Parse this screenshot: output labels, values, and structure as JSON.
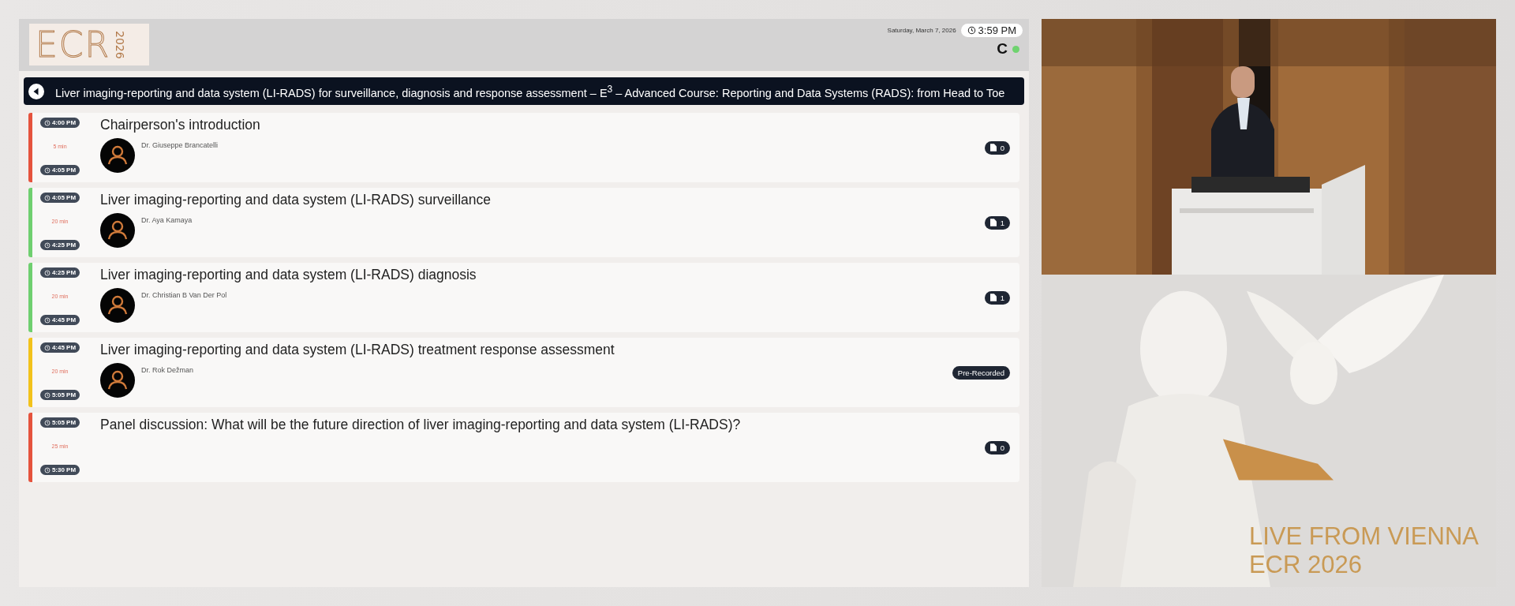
{
  "header": {
    "logo": {
      "letters": "ECR",
      "year": "2026"
    },
    "date": "Saturday, March 7, 2026",
    "time": "3:59 PM",
    "user_initial": "C"
  },
  "session_title": "Liver imaging-reporting and data system (LI-RADS) for surveillance, diagnosis and response assessment – E$^{3}$ – Advanced Course: Reporting and Data Systems (RADS): from Head to Toe",
  "talks": [
    {
      "start": "4:00 PM",
      "duration": "5 min",
      "end": "4:05 PM",
      "color": "#e5533d",
      "title": "Chairperson's introduction",
      "speaker": "Dr. Giuseppe Brancatelli",
      "badge": {
        "kind": "files",
        "text": "0"
      }
    },
    {
      "start": "4:05 PM",
      "duration": "20 min",
      "end": "4:25 PM",
      "color": "#6fcf6f",
      "title": "Liver imaging-reporting and data system (LI-RADS) surveillance",
      "speaker": "Dr. Aya Kamaya",
      "badge": {
        "kind": "files",
        "text": "1"
      }
    },
    {
      "start": "4:25 PM",
      "duration": "20 min",
      "end": "4:45 PM",
      "color": "#6fcf6f",
      "title": "Liver imaging-reporting and data system (LI-RADS) diagnosis",
      "speaker": "Dr. Christian B Van Der Pol",
      "badge": {
        "kind": "files",
        "text": "1"
      }
    },
    {
      "start": "4:45 PM",
      "duration": "20 min",
      "end": "5:05 PM",
      "color": "#f2c21b",
      "title": "Liver imaging-reporting and data system (LI-RADS) treatment response assessment",
      "speaker": "Dr. Rok Dežman",
      "badge": {
        "kind": "label",
        "text": "Pre-Recorded"
      }
    },
    {
      "start": "5:05 PM",
      "duration": "25 min",
      "end": "5:30 PM",
      "color": "#e5533d",
      "title": "Panel discussion: What will be the future direction of liver imaging-reporting and data system (LI-RADS)?",
      "badge": {
        "kind": "files",
        "text": "0"
      }
    }
  ],
  "live_banner": {
    "line_1": "LIVE FROM VIENNA",
    "line_2": "ECR 2026"
  }
}
